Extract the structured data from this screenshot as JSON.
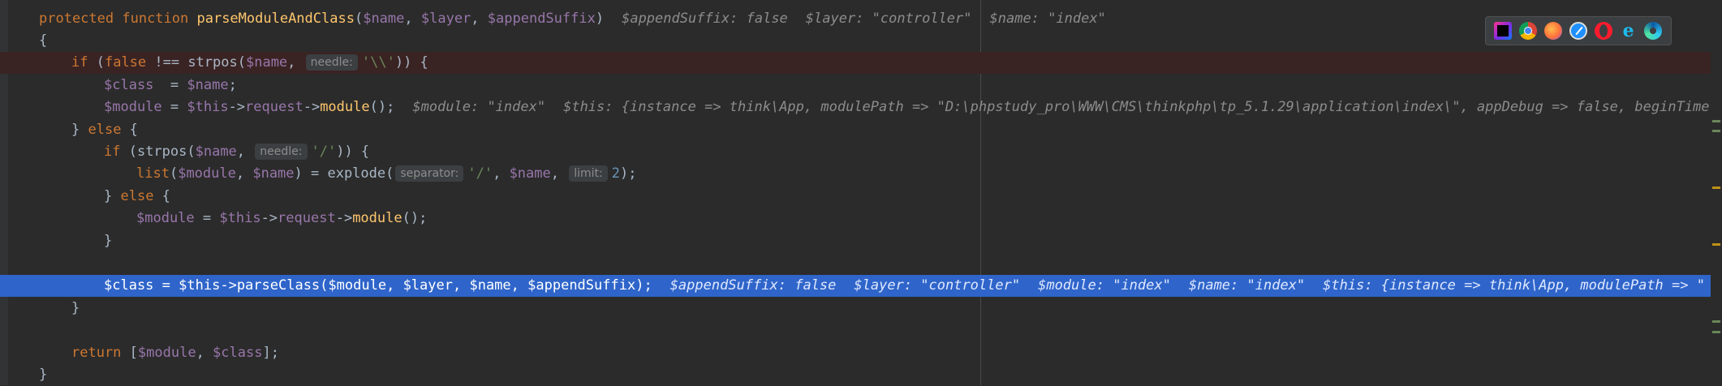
{
  "editor": {
    "lines": [
      {
        "id": "func-decl",
        "tokens": [
          {
            "c": "kw",
            "t": "protected "
          },
          {
            "c": "kw",
            "t": "function "
          },
          {
            "c": "fn",
            "t": "parseModuleAndClass"
          },
          {
            "c": "plain",
            "t": "("
          },
          {
            "c": "var",
            "t": "$name"
          },
          {
            "c": "plain",
            "t": ", "
          },
          {
            "c": "var",
            "t": "$layer"
          },
          {
            "c": "plain",
            "t": ", "
          },
          {
            "c": "var",
            "t": "$appendSuffix"
          },
          {
            "c": "plain",
            "t": ")"
          }
        ],
        "inlays": [
          "$appendSuffix: false",
          "$layer: \"controller\"",
          "$name: \"index\""
        ]
      },
      {
        "id": "open-brace",
        "tokens": [
          {
            "c": "plain",
            "t": "{"
          }
        ]
      },
      {
        "id": "if-strpos",
        "tokens": [
          {
            "c": "kw",
            "t": "if "
          },
          {
            "c": "plain",
            "t": "("
          },
          {
            "c": "kw",
            "t": "false "
          },
          {
            "c": "plain",
            "t": "!== strpos("
          },
          {
            "c": "var",
            "t": "$name"
          },
          {
            "c": "plain",
            "t": ", "
          },
          {
            "c": "hint",
            "t": "needle:"
          },
          {
            "c": "str",
            "t": "'\\\\'"
          },
          {
            "c": "plain",
            "t": ")) {"
          }
        ]
      },
      {
        "id": "class-assign",
        "tokens": [
          {
            "c": "var",
            "t": "$class"
          },
          {
            "c": "plain",
            "t": "  = "
          },
          {
            "c": "var",
            "t": "$name"
          },
          {
            "c": "plain",
            "t": ";"
          }
        ]
      },
      {
        "id": "module-assign",
        "tokens": [
          {
            "c": "var",
            "t": "$module"
          },
          {
            "c": "plain",
            "t": " = "
          },
          {
            "c": "var",
            "t": "$this"
          },
          {
            "c": "plain",
            "t": "->"
          },
          {
            "c": "var",
            "t": "request"
          },
          {
            "c": "plain",
            "t": "->"
          },
          {
            "c": "fn",
            "t": "module"
          },
          {
            "c": "plain",
            "t": "();"
          }
        ],
        "inlays": [
          "$module: \"index\"",
          "$this: {instance => think\\App, modulePath => \"D:\\phpstudy_pro\\WWW\\CMS\\thinkphp\\tp_5.1.29\\application\\index\\\", appDebug => false, beginTime =>"
        ]
      },
      {
        "id": "else-open",
        "tokens": [
          {
            "c": "plain",
            "t": "} "
          },
          {
            "c": "kw",
            "t": "else "
          },
          {
            "c": "plain",
            "t": "{"
          }
        ]
      },
      {
        "id": "if-slash",
        "tokens": [
          {
            "c": "kw",
            "t": "if "
          },
          {
            "c": "plain",
            "t": "(strpos("
          },
          {
            "c": "var",
            "t": "$name"
          },
          {
            "c": "plain",
            "t": ", "
          },
          {
            "c": "hint",
            "t": "needle:"
          },
          {
            "c": "str",
            "t": "'/'"
          },
          {
            "c": "plain",
            "t": ")) {"
          }
        ]
      },
      {
        "id": "list-explode",
        "tokens": [
          {
            "c": "kw",
            "t": "list"
          },
          {
            "c": "plain",
            "t": "("
          },
          {
            "c": "var",
            "t": "$module"
          },
          {
            "c": "plain",
            "t": ", "
          },
          {
            "c": "var",
            "t": "$name"
          },
          {
            "c": "plain",
            "t": ") = explode("
          },
          {
            "c": "hint",
            "t": "separator:"
          },
          {
            "c": "str",
            "t": "'/'"
          },
          {
            "c": "plain",
            "t": ", "
          },
          {
            "c": "var",
            "t": "$name"
          },
          {
            "c": "plain",
            "t": ", "
          },
          {
            "c": "hint",
            "t": "limit:"
          },
          {
            "c": "num",
            "t": "2"
          },
          {
            "c": "plain",
            "t": ");"
          }
        ]
      },
      {
        "id": "inner-else",
        "tokens": [
          {
            "c": "plain",
            "t": "} "
          },
          {
            "c": "kw",
            "t": "else "
          },
          {
            "c": "plain",
            "t": "{"
          }
        ]
      },
      {
        "id": "module-assign-2",
        "tokens": [
          {
            "c": "var",
            "t": "$module"
          },
          {
            "c": "plain",
            "t": " = "
          },
          {
            "c": "var",
            "t": "$this"
          },
          {
            "c": "plain",
            "t": "->"
          },
          {
            "c": "var",
            "t": "request"
          },
          {
            "c": "plain",
            "t": "->"
          },
          {
            "c": "fn",
            "t": "module"
          },
          {
            "c": "plain",
            "t": "();"
          }
        ]
      },
      {
        "id": "inner-close",
        "tokens": [
          {
            "c": "plain",
            "t": "}"
          }
        ]
      },
      {
        "id": "blank-1",
        "tokens": []
      },
      {
        "id": "parse-class",
        "tokens": [
          {
            "c": "var",
            "t": "$class"
          },
          {
            "c": "plain",
            "t": " = "
          },
          {
            "c": "var",
            "t": "$this"
          },
          {
            "c": "plain",
            "t": "->"
          },
          {
            "c": "fn",
            "t": "parseClass"
          },
          {
            "c": "plain",
            "t": "("
          },
          {
            "c": "var",
            "t": "$module"
          },
          {
            "c": "plain",
            "t": ", "
          },
          {
            "c": "var",
            "t": "$layer"
          },
          {
            "c": "plain",
            "t": ", "
          },
          {
            "c": "var",
            "t": "$name"
          },
          {
            "c": "plain",
            "t": ", "
          },
          {
            "c": "var",
            "t": "$appendSuffix"
          },
          {
            "c": "plain",
            "t": ");"
          }
        ],
        "inlays": [
          "$appendSuffix: false",
          "$layer: \"controller\"",
          "$module: \"index\"",
          "$name: \"index\"",
          "$this: {instance => think\\App, modulePath => \""
        ]
      },
      {
        "id": "outer-close",
        "tokens": [
          {
            "c": "plain",
            "t": "}"
          }
        ]
      },
      {
        "id": "blank-2",
        "tokens": []
      },
      {
        "id": "return",
        "tokens": [
          {
            "c": "kw",
            "t": "return "
          },
          {
            "c": "plain",
            "t": "["
          },
          {
            "c": "var",
            "t": "$module"
          },
          {
            "c": "plain",
            "t": ", "
          },
          {
            "c": "var",
            "t": "$class"
          },
          {
            "c": "plain",
            "t": "];"
          }
        ]
      },
      {
        "id": "func-close",
        "tokens": [
          {
            "c": "plain",
            "t": "}"
          }
        ]
      }
    ]
  },
  "browser_bar": {
    "icons": [
      "phpstorm-icon",
      "chrome-icon",
      "firefox-icon",
      "safari-icon",
      "opera-icon",
      "internet-explorer-icon",
      "edge-icon"
    ],
    "ie_glyph": "e"
  }
}
